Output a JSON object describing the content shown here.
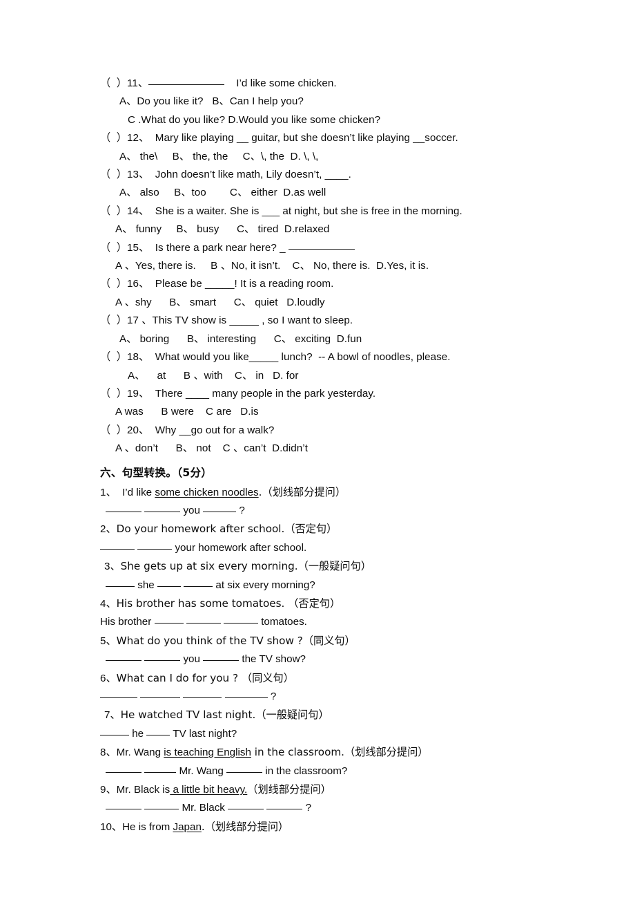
{
  "document": {
    "type": "english-exam-worksheet",
    "page_background": "#ffffff",
    "text_color": "#0c0c0c"
  },
  "multiple_choice": {
    "questions": [
      {
        "marker": "（  ）",
        "number": "11、",
        "stem_before_blank": "",
        "stem_after_blank": "    I’d like some chicken.",
        "blank_width": 110,
        "option_lines": [
          {
            "text": "A、Do you like it?   B、Can I help you?",
            "indent": "normal"
          },
          {
            "text": "C .What do you like? D.Would you like some chicken?",
            "indent": "deep"
          }
        ]
      },
      {
        "marker": "（  ）",
        "number": "12、",
        "stem": "  Mary like playing __ guitar, but she doesn’t like playing __soccer.",
        "option_lines": [
          {
            "text": "A、 the\\     B、 the, the     C、\\, the  D. \\, \\,",
            "indent": "normal"
          }
        ]
      },
      {
        "marker": "（  ）",
        "number": "13、",
        "stem": "  John doesn’t like math, Lily doesn’t, ____.",
        "option_lines": [
          {
            "text": "A、 also     B、too        C、 either  D.as well",
            "indent": "normal"
          }
        ]
      },
      {
        "marker": "（  ）",
        "number": "14、",
        "stem": "  She is a waiter. She is ___ at night, but she is free in the morning.",
        "option_lines": [
          {
            "text": "A、 funny     B、 busy      C、 tired  D.relaxed",
            "indent": "shallow"
          }
        ]
      },
      {
        "marker": "（  ）",
        "number": "15、",
        "stem_with_rule": "  Is there a park near here? _ ",
        "rule_width": 96,
        "option_lines": [
          {
            "text": "A 、Yes, there is.     B 、No, it isn’t.    C、 No, there is.  D.Yes, it is.",
            "indent": "shallow"
          }
        ]
      },
      {
        "marker": "（  ）",
        "number": "16、",
        "stem": "  Please be _____! It is a reading room.",
        "option_lines": [
          {
            "text": "A 、shy      B、 smart      C、 quiet   D.loudly",
            "indent": "shallow"
          }
        ]
      },
      {
        "marker": "（  ）",
        "number": "17 、",
        "stem": "This TV show is _____ , so I want to sleep.",
        "option_lines": [
          {
            "text": "A、 boring      B、 interesting      C、 exciting  D.fun",
            "indent": "normal"
          }
        ]
      },
      {
        "marker": "（  ）",
        "number": "18、",
        "stem": "  What would you like_____ lunch?  -- A bowl of noodles, please.",
        "option_lines": [
          {
            "text": "A、    at      B 、with    C、 in   D. for",
            "indent": "deep"
          }
        ]
      },
      {
        "marker": "（  ）",
        "number": "19、",
        "stem": "  There ____ many people in the park yesterday.",
        "option_lines": [
          {
            "text": "A was      B were    C are   D.is",
            "indent": "shallow"
          }
        ]
      },
      {
        "marker": "（  ）",
        "number": "20、",
        "stem": "  Why __go out for a walk?",
        "option_lines": [
          {
            "text": "A 、don’t      B、 not    C 、can’t  D.didn’t",
            "indent": "shallow"
          }
        ]
      }
    ]
  },
  "section_six": {
    "heading": "六、句型转换。（5分）",
    "items": [
      {
        "number": "1、",
        "lead": "  I’d like ",
        "underlined": "some chicken noodles",
        "tail": ".（划线部分提问）",
        "answer_blanks": [
          52,
          52
        ],
        "answer_mid": " you ",
        "answer_blanks_after": [
          48
        ],
        "answer_tail": " ?",
        "answer_indent": "ind1"
      },
      {
        "number": "2、",
        "lead": "Do your homework after school.（否定句）",
        "underlined": "",
        "tail": "",
        "answer_blanks": [
          50,
          50
        ],
        "answer_mid": " your homework after school.",
        "answer_blanks_after": [],
        "answer_tail": "",
        "answer_indent": "ind2"
      },
      {
        "number": "3、",
        "lead": "She gets up at six every morning.（一般疑问句）",
        "underlined": "",
        "tail": "",
        "answer_blanks": [
          42,
          34,
          42
        ],
        "answer_mid": "",
        "answer_blanks_after": [],
        "answer_tail": " at six every morning?",
        "answer_indent": "ind1",
        "answer_prefix_word": "",
        "answer_pattern": "blank she blank blank tail"
      },
      {
        "number": "4、",
        "lead": "His brother has some tomatoes. （否定句）",
        "underlined": "",
        "tail": "",
        "answer_prefix_word": "His brother ",
        "answer_blanks": [
          42,
          50,
          50
        ],
        "answer_tail": " tomatoes.",
        "answer_indent": "ind2"
      },
      {
        "number": "5、",
        "lead": "What do you think of the TV show ?（同义句）",
        "underlined": "",
        "tail": "",
        "answer_blanks": [
          52,
          52
        ],
        "answer_mid": " you ",
        "answer_blanks_after": [
          52
        ],
        "answer_tail": " the TV show?",
        "answer_indent": "ind1"
      },
      {
        "number": "6、",
        "lead": "What can I do for you ? （同义句）",
        "underlined": "",
        "tail": "",
        "answer_blanks": [
          54,
          58,
          56,
          62
        ],
        "answer_mid": "",
        "answer_blanks_after": [],
        "answer_tail": " ?",
        "answer_indent": "ind2"
      },
      {
        "number": "7、",
        "lead": "He watched TV last night.（一般疑问句）",
        "underlined": "",
        "tail": "",
        "answer_blanks": [
          42,
          34
        ],
        "answer_tail": " TV last night?",
        "answer_indent": "ind2",
        "answer_pattern": "blank he blank tail"
      },
      {
        "number": "8、",
        "lead": "Mr. Wang ",
        "underlined": "is teaching English",
        "tail": " in the classroom.（划线部分提问）",
        "answer_blanks": [
          52,
          46
        ],
        "answer_mid": " Mr. Wang ",
        "answer_blanks_after": [
          52
        ],
        "answer_tail": " in the classroom?",
        "answer_indent": "ind1"
      },
      {
        "number": "9、",
        "lead": "Mr. Black is",
        "underlined": " a little bit heavy.",
        "tail": "（划线部分提问）",
        "answer_blanks": [
          52,
          50
        ],
        "answer_mid": " Mr. Black ",
        "answer_blanks_after": [
          52,
          52
        ],
        "answer_tail": " ?",
        "answer_indent": "ind1"
      },
      {
        "number": "10、",
        "lead": "He is from ",
        "underlined": "Japan",
        "tail": ".（划线部分提问）",
        "answer_blanks": [],
        "answer_mid": "",
        "answer_blanks_after": [],
        "answer_tail": "",
        "answer_indent": "ind2"
      }
    ]
  }
}
